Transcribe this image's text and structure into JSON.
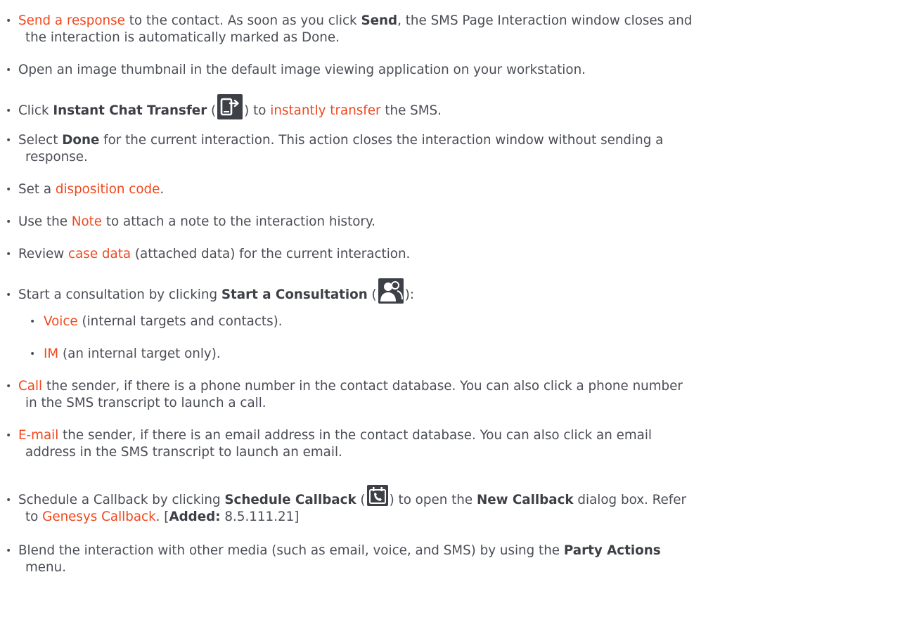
{
  "items": [
    {
      "link": "Send a response",
      "text1": " to the contact. As soon as you click ",
      "bold": "Send",
      "text2": ", the SMS Page Interaction window closes and",
      "cont": "the interaction is automatically marked as Done."
    },
    {
      "text": "Open an image thumbnail in the default image viewing application on your workstation."
    },
    {
      "text1": "Click ",
      "bold": "Instant Chat Transfer",
      "text2": " (",
      "icon": "transfer-icon",
      "text3": ") to ",
      "link": "instantly transfer",
      "text4": " the SMS."
    },
    {
      "text1": "Select ",
      "bold": "Done",
      "text2": " for the current interaction. This action closes the interaction window without sending a",
      "cont": "response."
    },
    {
      "text1": "Set a ",
      "link": "disposition code",
      "text2": "."
    },
    {
      "text1": "Use the ",
      "link": "Note",
      "text2": " to attach a note to the interaction history."
    },
    {
      "text1": "Review ",
      "link": "case data",
      "text2": " (attached data) for the current interaction."
    },
    {
      "text1": "Start a consultation by clicking ",
      "bold": "Start a Consultation",
      "text2": " (",
      "icon": "consultation-icon",
      "text3": "):",
      "subitems": [
        {
          "link": "Voice",
          "text": " (internal targets and contacts)."
        },
        {
          "link": "IM",
          "text": " (an internal target only)."
        }
      ]
    },
    {
      "link": "Call",
      "text1": " the sender, if there is a phone number in the contact database. You can also click a phone number",
      "cont": "in the SMS transcript to launch a call."
    },
    {
      "link": "E-mail",
      "text1": " the sender, if there is an email address in the contact database. You can also click an email",
      "cont": "address in the SMS transcript to launch an email."
    },
    {
      "text1": "Schedule a Callback by clicking ",
      "bold": "Schedule Callback",
      "text2": " (",
      "icon": "schedule-callback-icon",
      "text3": ") to open the ",
      "bold2": "New Callback",
      "text4": " dialog box. Refer",
      "cont_text1": "to ",
      "cont_link": "Genesys Callback",
      "cont_text2": ". [",
      "cont_bold": "Added:",
      "cont_text3": " 8.5.111.21]"
    },
    {
      "text1": "Blend the interaction with other media (such as email, voice, and SMS) by using the ",
      "bold": "Party Actions",
      "cont": "menu."
    }
  ],
  "colors": {
    "text": "#4a4d55",
    "link": "#f0471d",
    "icon_bg": "#3d4147"
  }
}
